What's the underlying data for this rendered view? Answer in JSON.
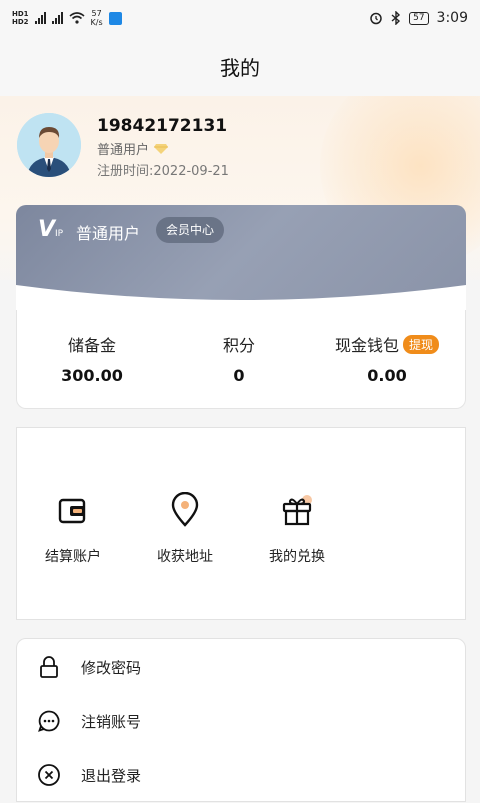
{
  "status_bar": {
    "net_speed_value": "57",
    "net_speed_unit": "K/s",
    "battery": "57",
    "time": "3:09"
  },
  "page": {
    "title": "我的"
  },
  "profile": {
    "phone": "19842172131",
    "user_type": "普通用户",
    "register_label": "注册时间:2022-09-21"
  },
  "vip": {
    "logo_main": "V",
    "logo_sub": "IP",
    "level": "普通用户",
    "center_button": "会员中心"
  },
  "stats": [
    {
      "label": "储备金",
      "value": "300.00"
    },
    {
      "label": "积分",
      "value": "0"
    },
    {
      "label": "现金钱包",
      "value": "0.00",
      "badge": "提现"
    }
  ],
  "features": [
    {
      "label": "结算账户",
      "icon": "wallet-icon"
    },
    {
      "label": "收获地址",
      "icon": "location-pin-icon"
    },
    {
      "label": "我的兑换",
      "icon": "gift-icon"
    }
  ],
  "menu": [
    {
      "label": "修改密码",
      "icon": "lock-icon"
    },
    {
      "label": "注销账号",
      "icon": "chat-bubble-icon"
    },
    {
      "label": "退出登录",
      "icon": "close-circle-icon"
    }
  ],
  "colors": {
    "accent_orange": "#f08c1a",
    "vip_card": "#8a93a8",
    "hero_bg": "#fbf2e8"
  }
}
